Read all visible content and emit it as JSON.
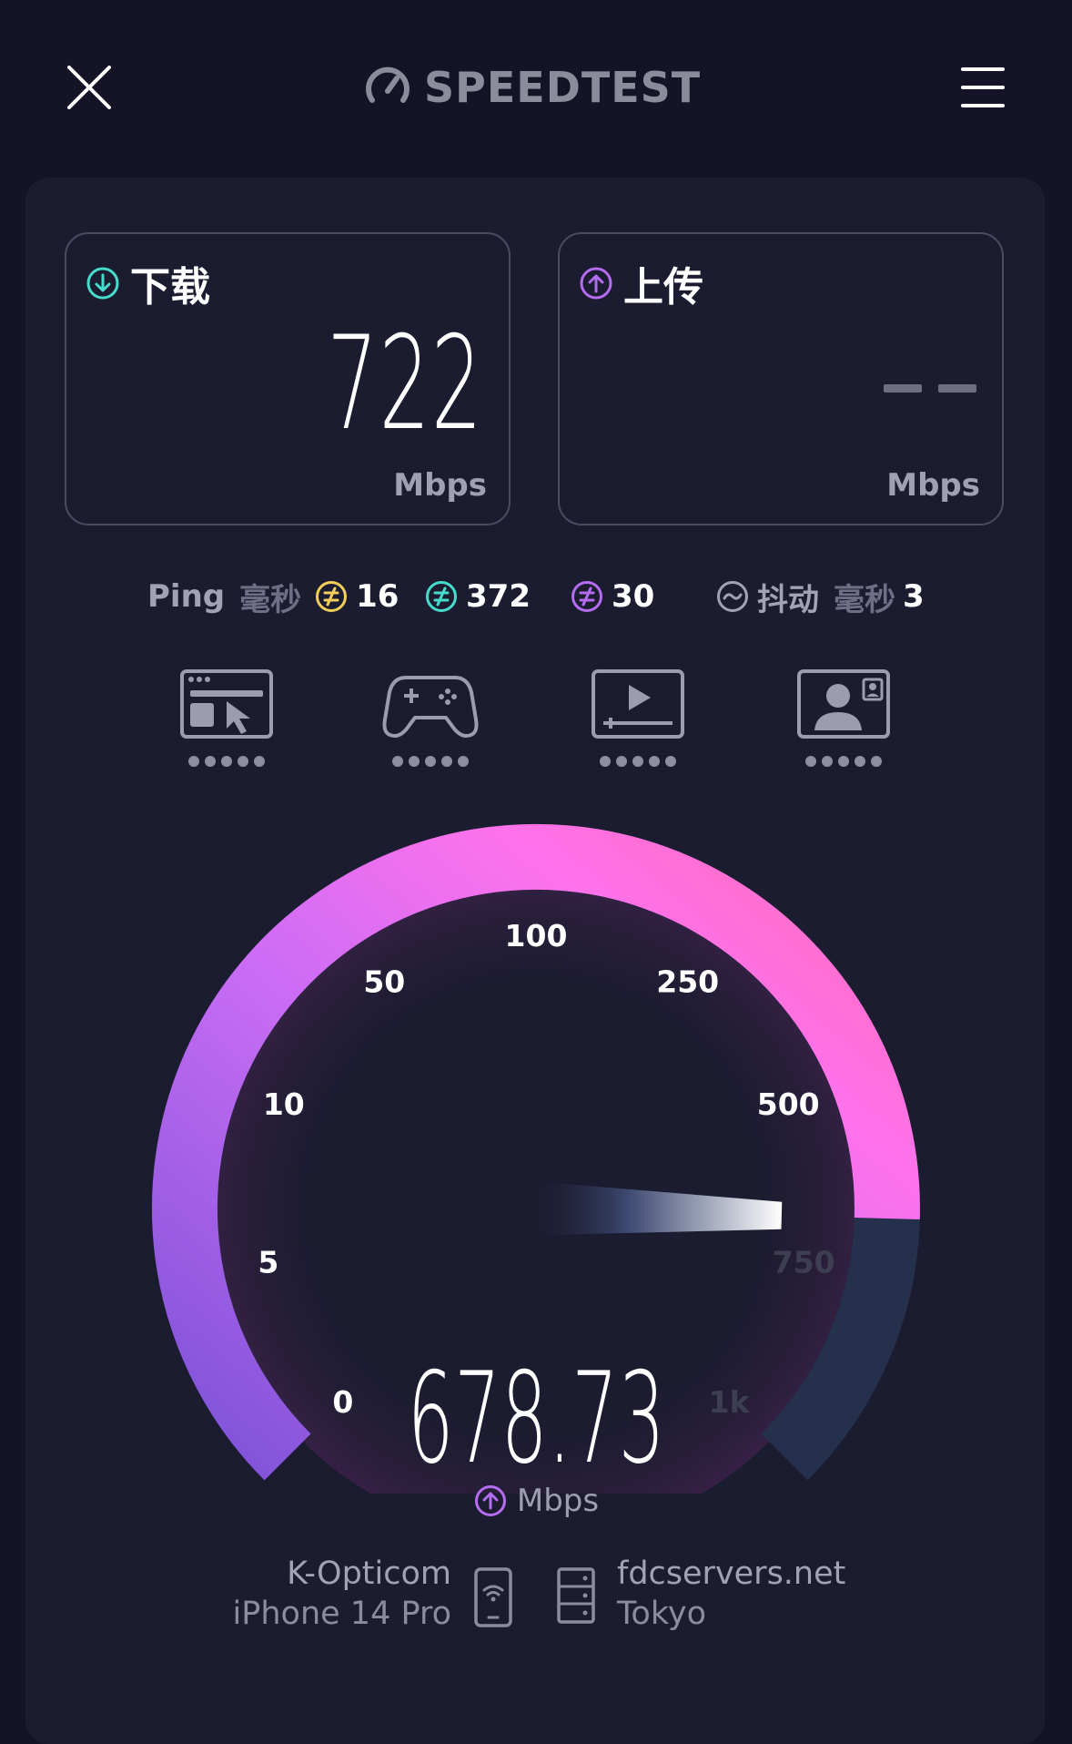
{
  "header": {
    "brand": "SPEEDTEST",
    "close_icon": "close-icon",
    "menu_icon": "hamburger-menu-icon"
  },
  "download": {
    "title": "下载",
    "value": "722",
    "unit": "Mbps",
    "icon": "download-arrow-icon"
  },
  "upload": {
    "title": "上传",
    "value": "",
    "unit": "Mbps",
    "icon": "upload-arrow-icon"
  },
  "ping": {
    "label": "Ping",
    "unit": "毫秒",
    "idle": "16",
    "download": "372",
    "upload": "30"
  },
  "jitter": {
    "label": "抖动",
    "unit": "毫秒",
    "value": "3"
  },
  "quality_icons": [
    "web-browsing-icon",
    "gaming-icon",
    "video-streaming-icon",
    "video-call-icon"
  ],
  "gauge": {
    "ticks": [
      "0",
      "5",
      "10",
      "50",
      "100",
      "250",
      "500",
      "750",
      "1k"
    ],
    "speed": "678.73",
    "unit": "Mbps",
    "speed_value": 678.73,
    "colors": {
      "arc_start": "#8e5ae0",
      "arc_mid": "#e06cf5",
      "arc_end": "#ff6ec0",
      "track": "#24304c"
    }
  },
  "footer": {
    "isp": "K-Opticom",
    "device": "iPhone 14 Pro",
    "server": "fdcservers.net",
    "location": "Tokyo"
  },
  "colors": {
    "background": "#141426",
    "panel": "#1c1c30",
    "download_accent": "#46dccc",
    "upload_accent": "#b46cf0",
    "idle_ping": "#f2cf5a"
  }
}
